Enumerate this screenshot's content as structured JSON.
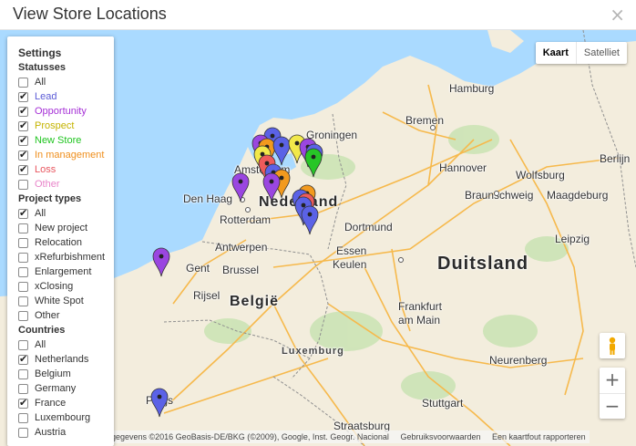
{
  "dialog": {
    "title": "View Store Locations",
    "close_label": "×"
  },
  "map": {
    "map_type_buttons": [
      {
        "label": "Kaart",
        "active": true
      },
      {
        "label": "Satelliet",
        "active": false
      }
    ],
    "zoom_in_label": "+",
    "zoom_out_label": "−",
    "attribution": {
      "text": "gegevens ©2016 GeoBasis-DE/BKG (©2009), Google, Inst. Geogr. Nacional",
      "terms": "Gebruiksvoorwaarden",
      "report": "Een kaartfout rapporteren"
    },
    "labels": {
      "hamburg": "Hamburg",
      "bremen": "Bremen",
      "groningen": "Groningen",
      "amsterdam": "Amsterdam",
      "den_haag": "Den Haag",
      "rotterdam": "Rotterdam",
      "nederland": "Nederland",
      "hannover": "Hannover",
      "wolfsburg": "Wolfsburg",
      "berlijn": "Berlijn",
      "braunschweig": "Braunschweig",
      "magdeburg": "Maagdeburg",
      "dortmund": "Dortmund",
      "essen": "Essen",
      "leipzig": "Leipzig",
      "antwerpen": "Antwerpen",
      "gent": "Gent",
      "brussel": "Brussel",
      "keulen": "Keulen",
      "duitsland": "Duitsland",
      "rijsel": "Rijsel",
      "belgie": "België",
      "frankfurt": "Frankfurt",
      "am_main": "am Main",
      "luxemburg": "Luxemburg",
      "neurenberg": "Neurenberg",
      "stuttgart": "Stuttgart",
      "parijs": "Parijs",
      "straatsburg": "Straatsburg"
    }
  },
  "settings": {
    "title": "Settings",
    "statuses": {
      "heading": "Statusses",
      "items": [
        {
          "label": "All",
          "checked": false,
          "color": "#333333"
        },
        {
          "label": "Lead",
          "checked": true,
          "color": "#5b5bd6"
        },
        {
          "label": "Opportunity",
          "checked": true,
          "color": "#a52fd6"
        },
        {
          "label": "Prospect",
          "checked": true,
          "color": "#c4b300"
        },
        {
          "label": "New Store",
          "checked": true,
          "color": "#1fc41f"
        },
        {
          "label": "In management",
          "checked": true,
          "color": "#ef8f1d"
        },
        {
          "label": "Loss",
          "checked": true,
          "color": "#e8565f"
        },
        {
          "label": "Other",
          "checked": false,
          "color": "#e884c9"
        }
      ]
    },
    "project_types": {
      "heading": "Project types",
      "items": [
        {
          "label": "All",
          "checked": true
        },
        {
          "label": "New project",
          "checked": false
        },
        {
          "label": "Relocation",
          "checked": false
        },
        {
          "label": "xRefurbishment",
          "checked": false
        },
        {
          "label": "Enlargement",
          "checked": false
        },
        {
          "label": "xClosing",
          "checked": false
        },
        {
          "label": "White Spot",
          "checked": false
        },
        {
          "label": "Other",
          "checked": false
        }
      ]
    },
    "countries": {
      "heading": "Countries",
      "items": [
        {
          "label": "All",
          "checked": false
        },
        {
          "label": "Netherlands",
          "checked": true
        },
        {
          "label": "Belgium",
          "checked": false
        },
        {
          "label": "Germany",
          "checked": false
        },
        {
          "label": "France",
          "checked": true
        },
        {
          "label": "Luxembourg",
          "checked": false
        },
        {
          "label": "Austria",
          "checked": false
        }
      ]
    }
  },
  "pin_colors": {
    "lead": "#5b62e6",
    "opportunity": "#9a46e0",
    "prospect": "#f2e84a",
    "new_store": "#27c627",
    "in_management": "#f29a1e",
    "loss": "#ee5b5b"
  }
}
